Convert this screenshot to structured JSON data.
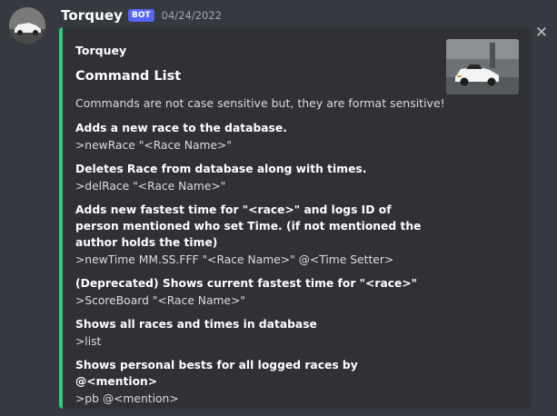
{
  "message": {
    "username": "Torquey",
    "bot_tag": "BOT",
    "timestamp": "04/24/2022",
    "close_symbol": "✕"
  },
  "embed": {
    "accent_color": "#2ecc71",
    "author": "Torquey",
    "title": "Command List",
    "description": "Commands are not case sensitive but, they are format sensitive!",
    "commands": [
      {
        "description": "Adds a new race to the database.",
        "syntax": ">newRace \"<Race Name>\""
      },
      {
        "description": "Deletes Race from database along with times.",
        "syntax": ">delRace \"<Race Name>\""
      },
      {
        "description": "Adds new fastest time for \"<race>\" and logs ID of person mentioned who set Time. (if not mentioned the author holds the time)",
        "syntax": ">newTime MM.SS.FFF \"<Race Name>\" @<Time Setter>"
      },
      {
        "description": "(Deprecated) Shows current fastest time for \"<race>\"",
        "syntax": ">ScoreBoard \"<Race Name>\""
      },
      {
        "description": "Shows all races and times in database",
        "syntax": ">list"
      },
      {
        "description": "Shows personal bests for all logged races by @<mention>",
        "syntax": ">pb @<mention>"
      }
    ]
  },
  "colors": {
    "background": "#36393f",
    "embed_background": "#2f3136",
    "bot_tag": "#5865f2",
    "timestamp": "#a3a6aa"
  }
}
